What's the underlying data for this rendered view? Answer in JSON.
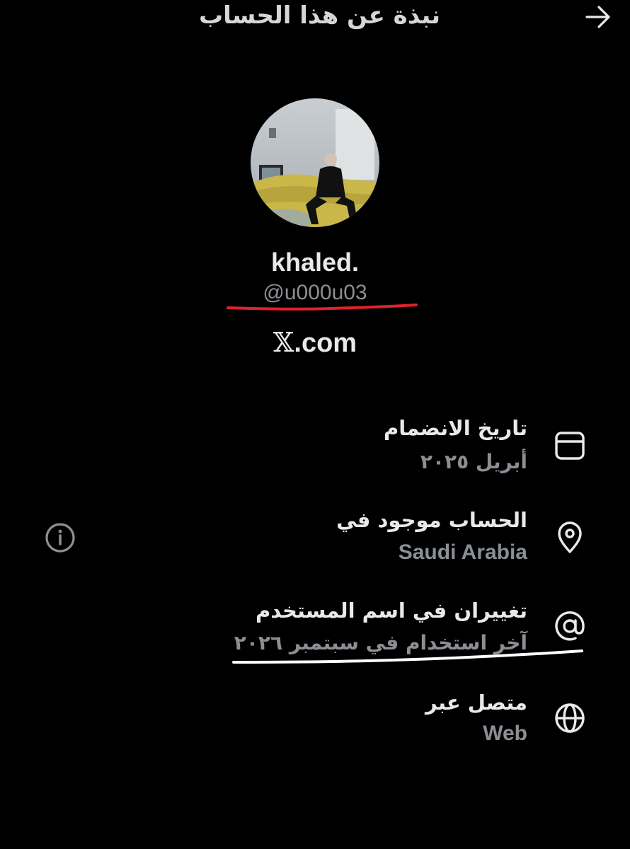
{
  "header": {
    "title": "نبذة عن هذا الحساب",
    "back_icon": "arrow-right-icon"
  },
  "profile": {
    "display_name": "khaled.",
    "handle": "@u000u03",
    "platform_logo": "𝕏",
    "platform_suffix": ".com"
  },
  "rows": [
    {
      "icon": "calendar-icon",
      "title": "تاريخ الانضمام",
      "value": "أبريل ٢٠٢٥"
    },
    {
      "icon": "location-pin-icon",
      "title": "الحساب موجود في",
      "value": "Saudi Arabia"
    },
    {
      "icon": "at-sign-icon",
      "title": "تغييران في اسم المستخدم",
      "value": "آخر استخدام في سبتمبر ٢٠٢٦"
    },
    {
      "icon": "globe-icon",
      "title": "متصل عبر",
      "value": "Web"
    }
  ],
  "info_icon": "info-icon",
  "colors": {
    "background": "#000000",
    "primary_text": "#e7e9ea",
    "secondary_text": "#8b8f93",
    "annotation_red": "#e0222b",
    "annotation_white": "#ffffff"
  }
}
